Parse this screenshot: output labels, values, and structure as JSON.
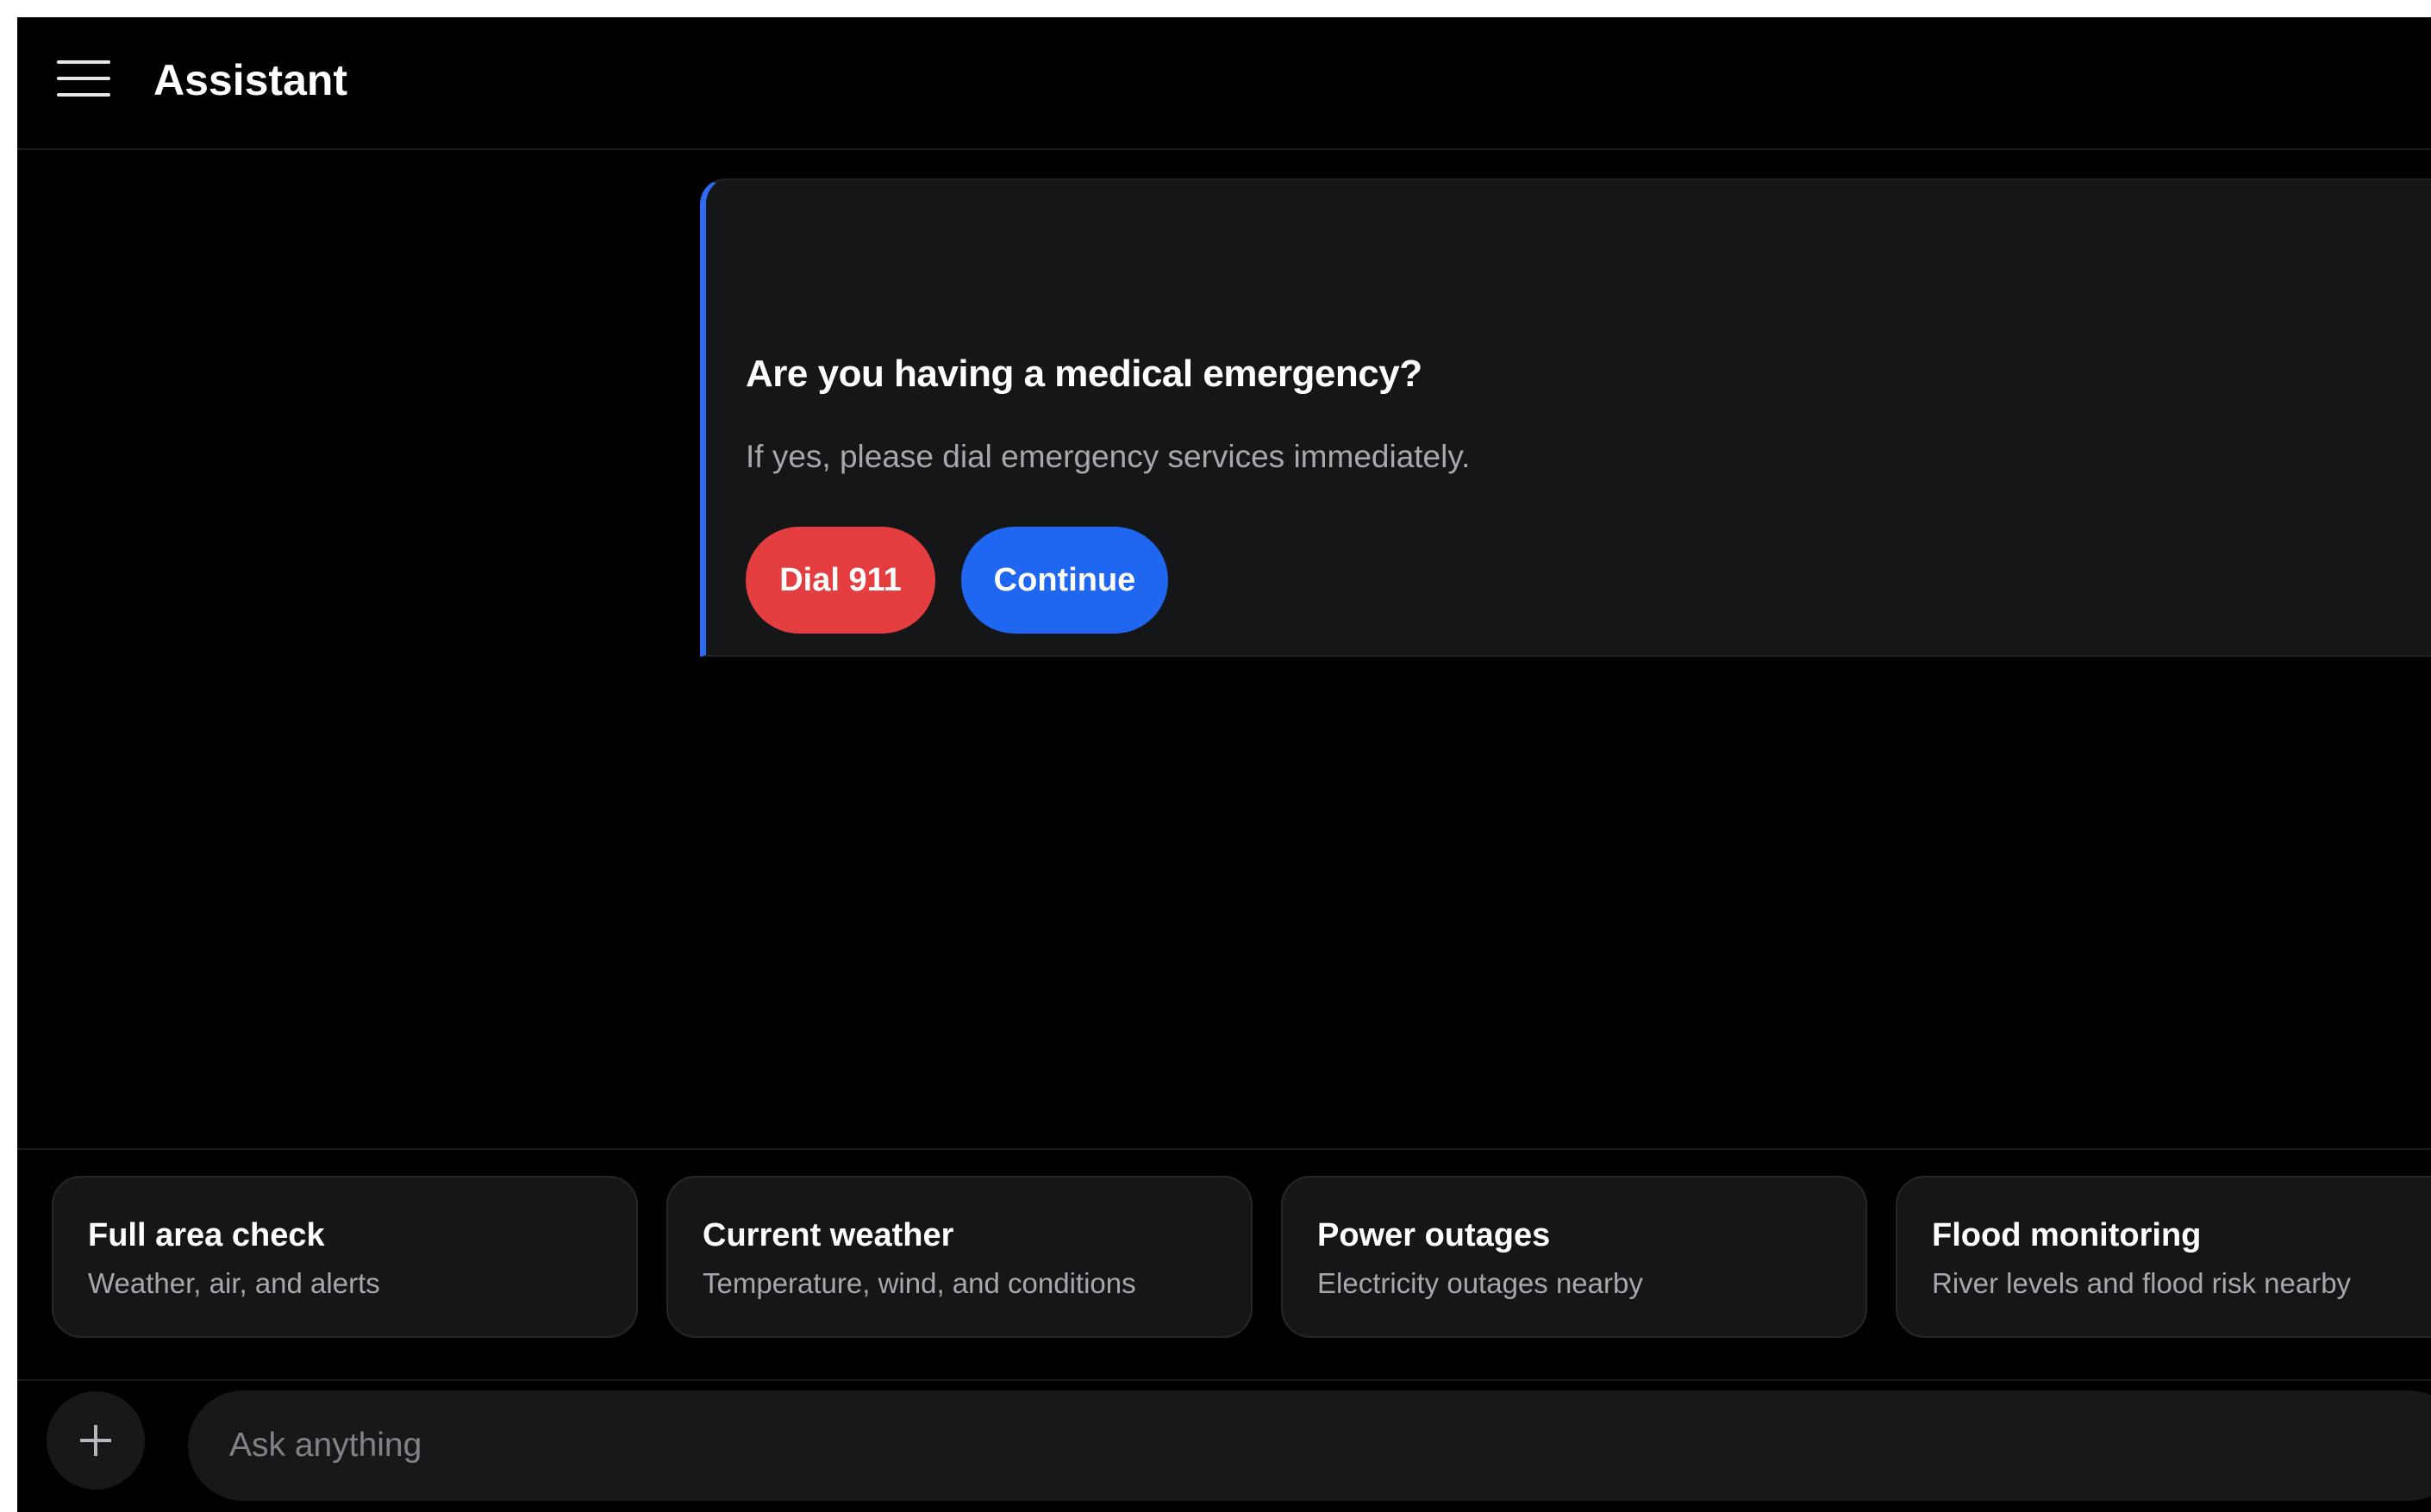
{
  "header": {
    "title": "Assistant",
    "menu_icon": "hamburger-menu-icon"
  },
  "emergency_card": {
    "title": "Are you having a medical emergency?",
    "text": "If yes, please dial emergency services immediately.",
    "dial_label": "Dial 911",
    "continue_label": "Continue",
    "accent_color": "#2f6bf2",
    "dial_color": "#e53e40",
    "continue_color": "#1f66f1"
  },
  "suggestions": [
    {
      "title": "Full area check",
      "subtitle": "Weather, air, and alerts"
    },
    {
      "title": "Current weather",
      "subtitle": "Temperature, wind, and conditions"
    },
    {
      "title": "Power outages",
      "subtitle": "Electricity outages nearby"
    },
    {
      "title": "Flood monitoring",
      "subtitle": "River levels and flood risk nearby"
    }
  ],
  "composer": {
    "plus_icon": "plus-icon",
    "placeholder": "Ask anything",
    "value": ""
  }
}
